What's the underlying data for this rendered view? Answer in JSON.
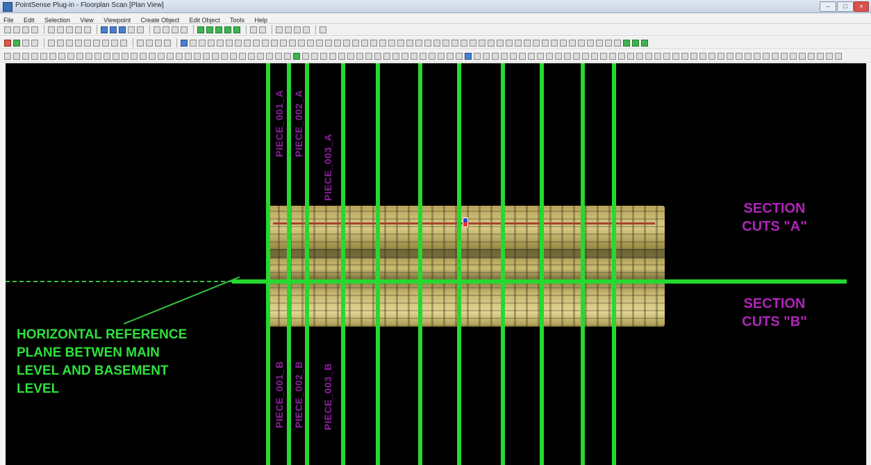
{
  "window": {
    "title": "PointSense Plug-in - Floorplan Scan [Plan View]"
  },
  "menubar": {
    "items": [
      "File",
      "Edit",
      "Selection",
      "View",
      "Viewpoint",
      "Create Object",
      "Edit Object",
      "Tools",
      "Help"
    ]
  },
  "viewport": {
    "section_a": {
      "line1": "SECTION",
      "line2": "CUTS \"A\""
    },
    "section_b": {
      "line1": "SECTION",
      "line2": "CUTS \"B\""
    },
    "reference_note": {
      "line1": "HORIZONTAL REFERENCE",
      "line2": "PLANE BETWEN MAIN",
      "line3": "LEVEL AND BASEMENT",
      "line4": "LEVEL"
    },
    "piece_labels": {
      "p001a": "PIECE_001_A",
      "p002a": "PIECE_002_A",
      "p003a": "PIECE_003_A",
      "p001b": "PIECE_001_B",
      "p002b": "PIECE_002_B",
      "p003b": "PIECE_003_B"
    }
  },
  "colors": {
    "background": "#000000",
    "cut_lines": "#25d92f",
    "section_text": "#b024b8",
    "note_text": "#2fe03c"
  }
}
